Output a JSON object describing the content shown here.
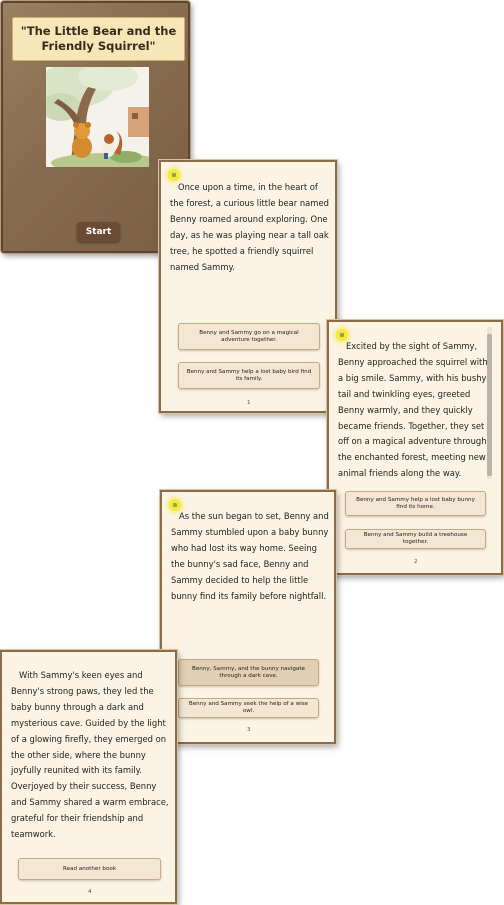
{
  "cover": {
    "title": "\"The Little Bear and the Friendly Squirrel\"",
    "start_label": "Start"
  },
  "pages": [
    {
      "number": "1",
      "text": "Once upon a time, in the heart of the forest, a curious little bear named Benny roamed around exploring. One day, as he was playing near a tall oak tree, he spotted a friendly squirrel named Sammy.",
      "choices": [
        "Benny and Sammy go on a magical adventure together.",
        "Benny and Sammy help a lost baby bird find its family."
      ]
    },
    {
      "number": "2",
      "text": "Excited by the sight of Sammy, Benny approached the squirrel with a big smile. Sammy, with his bushy tail and twinkling eyes, greeted Benny warmly, and they quickly became friends. Together, they set off on a magical adventure through the enchanted forest, meeting new animal friends along the way.",
      "choices": [
        "Benny and Sammy help a lost baby bunny find its home.",
        "Benny and Sammy build a treehouse together."
      ]
    },
    {
      "number": "3",
      "text": "As the sun began to set, Benny and Sammy stumbled upon a baby bunny who had lost its way home. Seeing the bunny's sad face, Benny and Sammy decided to help the little bunny find its family before nightfall.",
      "choices": [
        "Benny, Sammy, and the bunny navigate through a dark cave.",
        "Benny and Sammy seek the help of a wise owl."
      ]
    },
    {
      "number": "4",
      "text": "With Sammy's keen eyes and Benny's strong paws, they led the baby bunny through a dark and mysterious cave. Guided by the light of a glowing firefly, they emerged on the other side, where the bunny joyfully reunited with its family. Overjoyed by their success, Benny and Sammy shared a warm embrace, grateful for their friendship and teamwork.",
      "choices": [
        "Read another book"
      ]
    }
  ],
  "icons": {
    "audio": "speaker-icon"
  },
  "colors": {
    "cover_bg": "#856a4e",
    "page_bg": "#fbf3e3",
    "button_bg": "#f3e6d3",
    "start_bg": "#6b4b35",
    "audio_glow": "#f3eb3a"
  }
}
